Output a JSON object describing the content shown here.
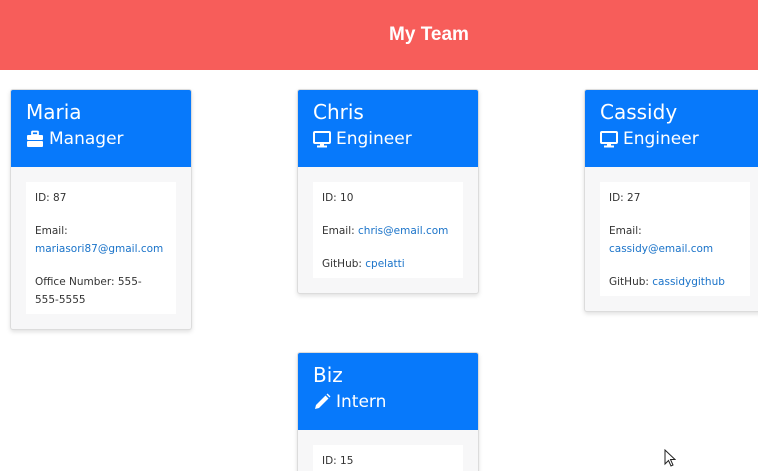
{
  "header": {
    "title": "My Team"
  },
  "colors": {
    "header_bg": "#f75d5a",
    "card_head_bg": "#0779fb",
    "link": "#1a73c9"
  },
  "cards": [
    {
      "name": "Maria",
      "role": "Manager",
      "icon": "briefcase-icon",
      "id_label": "ID: 87",
      "email_label": "Email:",
      "email": "mariasori87@gmail.com",
      "extra_label": "Office Number: 555-555-5555"
    },
    {
      "name": "Chris",
      "role": "Engineer",
      "icon": "monitor-icon",
      "id_label": "ID: 10",
      "email_label": "Email:",
      "email": "chris@email.com",
      "github_label": "GitHub:",
      "github": "cpelatti"
    },
    {
      "name": "Cassidy",
      "role": "Engineer",
      "icon": "monitor-icon",
      "id_label": "ID: 27",
      "email_label": "Email:",
      "email": "cassidy@email.com",
      "github_label": "GitHub:",
      "github": "cassidygithub"
    },
    {
      "name": "Biz",
      "role": "Intern",
      "icon": "pencil-icon",
      "id_label": "ID: 15"
    }
  ]
}
